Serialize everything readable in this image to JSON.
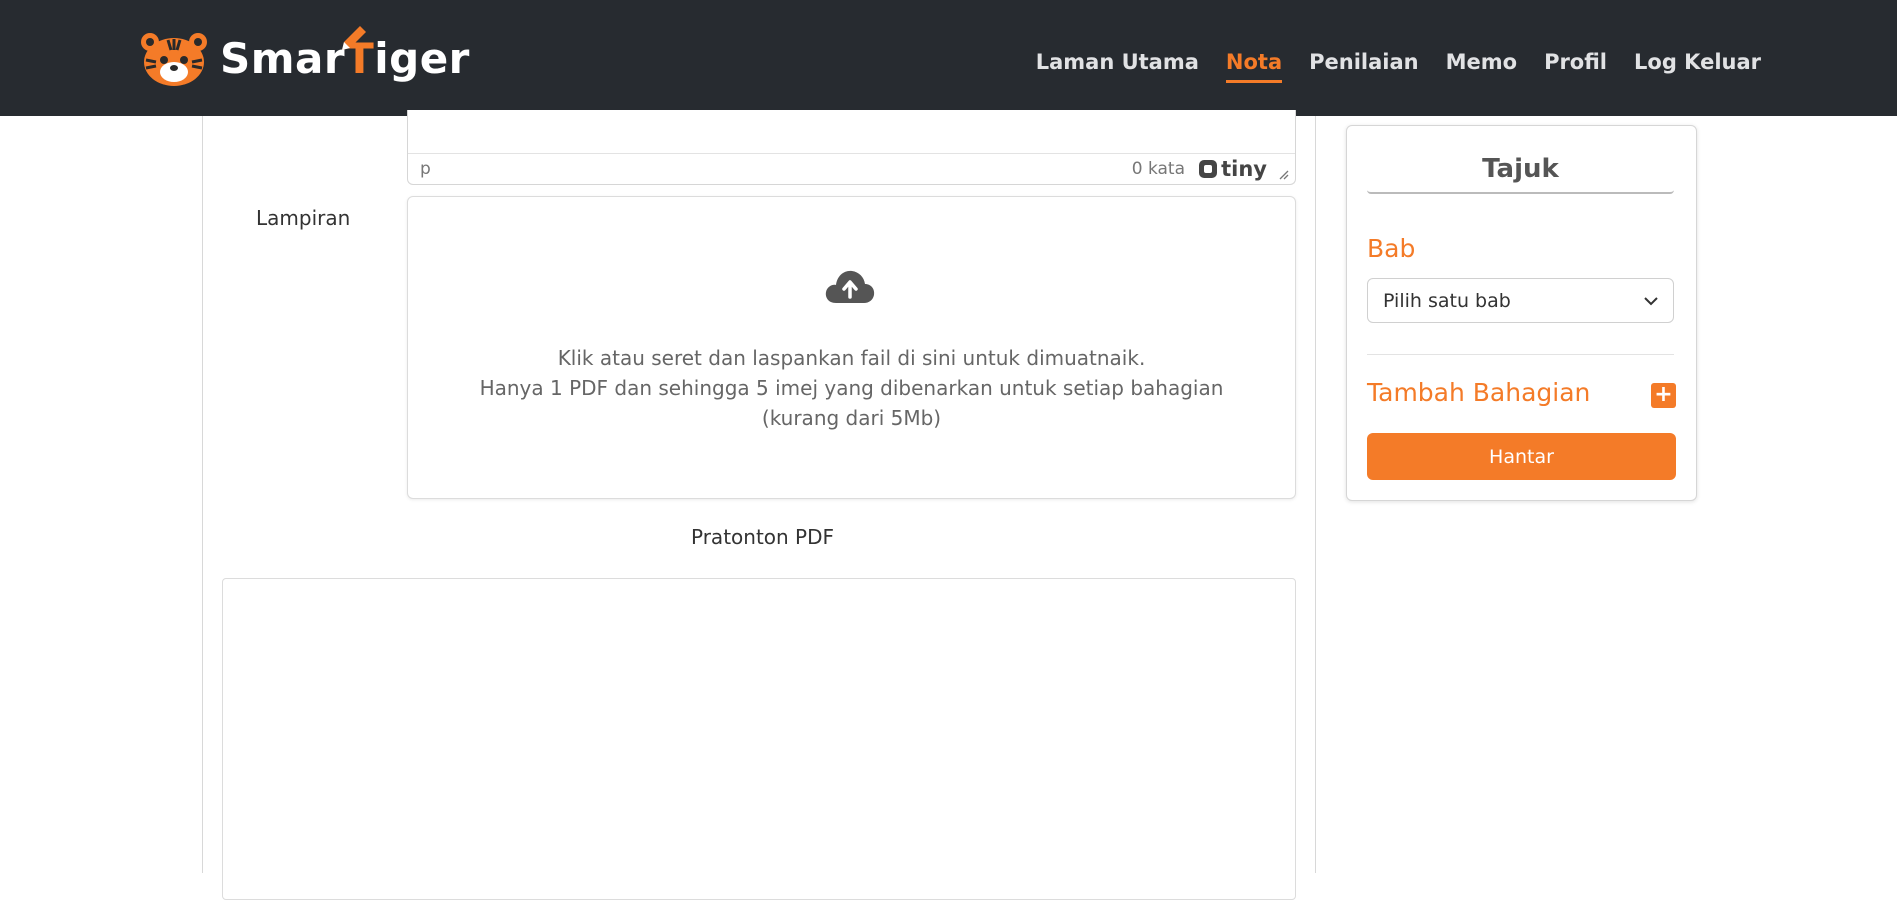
{
  "brand": {
    "name_prefix": "Smar",
    "name_t": "T",
    "name_suffix": "iger"
  },
  "nav": {
    "items": [
      {
        "label": "Laman Utama"
      },
      {
        "label": "Nota"
      },
      {
        "label": "Penilaian"
      },
      {
        "label": "Memo"
      },
      {
        "label": "Profil"
      },
      {
        "label": "Log Keluar"
      }
    ],
    "active": "Nota"
  },
  "editor": {
    "element_path": "p",
    "word_count": "0 kata",
    "brand": "tiny"
  },
  "attachment": {
    "label": "Lampiran",
    "instruction_line1": "Klik atau seret dan laspankan fail di sini untuk dimuatnaik.",
    "instruction_line2": "Hanya 1 PDF dan sehingga 5 imej yang dibenarkan untuk setiap bahagian (kurang dari 5Mb)"
  },
  "preview": {
    "label": "Pratonton PDF"
  },
  "sidebar": {
    "title": "Tajuk",
    "chapter_label": "Bab",
    "chapter_select_value": "Pilih satu bab",
    "add_section_label": "Tambah Bahagian",
    "add_section_icon": "+",
    "submit_label": "Hantar"
  },
  "colors": {
    "accent": "#f47b28",
    "header_bg": "#272b30"
  }
}
